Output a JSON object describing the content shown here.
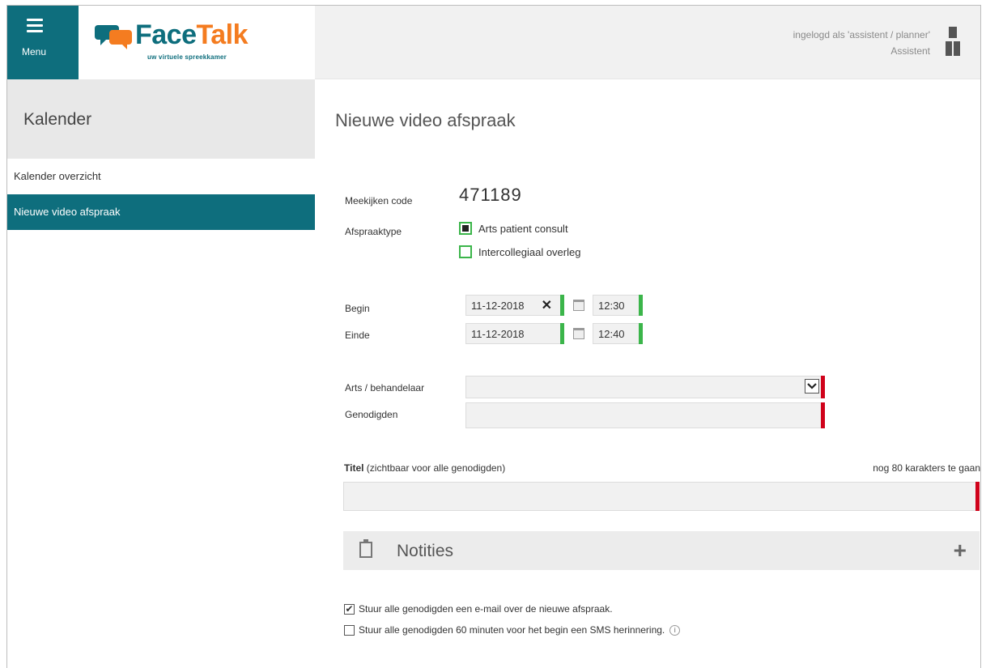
{
  "header": {
    "menu_label": "Menu",
    "logo_face": "Face",
    "logo_talk": "Talk",
    "logo_tagline": "uw virtuele spreekkamer",
    "logged_in_as": "ingelogd als 'assistent / planner'",
    "role": "Assistent"
  },
  "sidebar": {
    "title": "Kalender",
    "items": [
      {
        "label": "Kalender overzicht",
        "active": false
      },
      {
        "label": "Nieuwe video afspraak",
        "active": true
      }
    ]
  },
  "form": {
    "page_title": "Nieuwe video afspraak",
    "meekijken_label": "Meekijken code",
    "meekijken_code": "471189",
    "afspraaktype_label": "Afspraaktype",
    "afspraaktype_options": [
      {
        "label": "Arts patient consult",
        "selected": true
      },
      {
        "label": "Intercollegiaal overleg",
        "selected": false
      }
    ],
    "begin_label": "Begin",
    "begin_date": "11-12-2018",
    "begin_time": "12:30",
    "einde_label": "Einde",
    "einde_date": "11-12-2018",
    "einde_time": "12:40",
    "clear_symbol": "✕",
    "arts_label": "Arts / behandelaar",
    "arts_value": "",
    "genodigden_label": "Genodigden",
    "genodigden_value": "",
    "titel_label_bold": "Titel",
    "titel_label_rest": " (zichtbaar voor alle genodigden)",
    "titel_remaining": "nog 80 karakters te gaan",
    "titel_value": "",
    "notities_label": "Notities",
    "notities_plus": "+",
    "email_option": {
      "label": "Stuur alle genodigden een e-mail over de nieuwe afspraak.",
      "checked": true
    },
    "sms_option": {
      "label": "Stuur alle genodigden 60 minuten voor het begin een SMS herinnering.",
      "checked": false
    },
    "info_symbol": "i"
  },
  "colors": {
    "brand_teal": "#0e6e7d",
    "brand_orange": "#f47c20",
    "valid_green": "#3bb54a",
    "required_red": "#d0021b"
  }
}
